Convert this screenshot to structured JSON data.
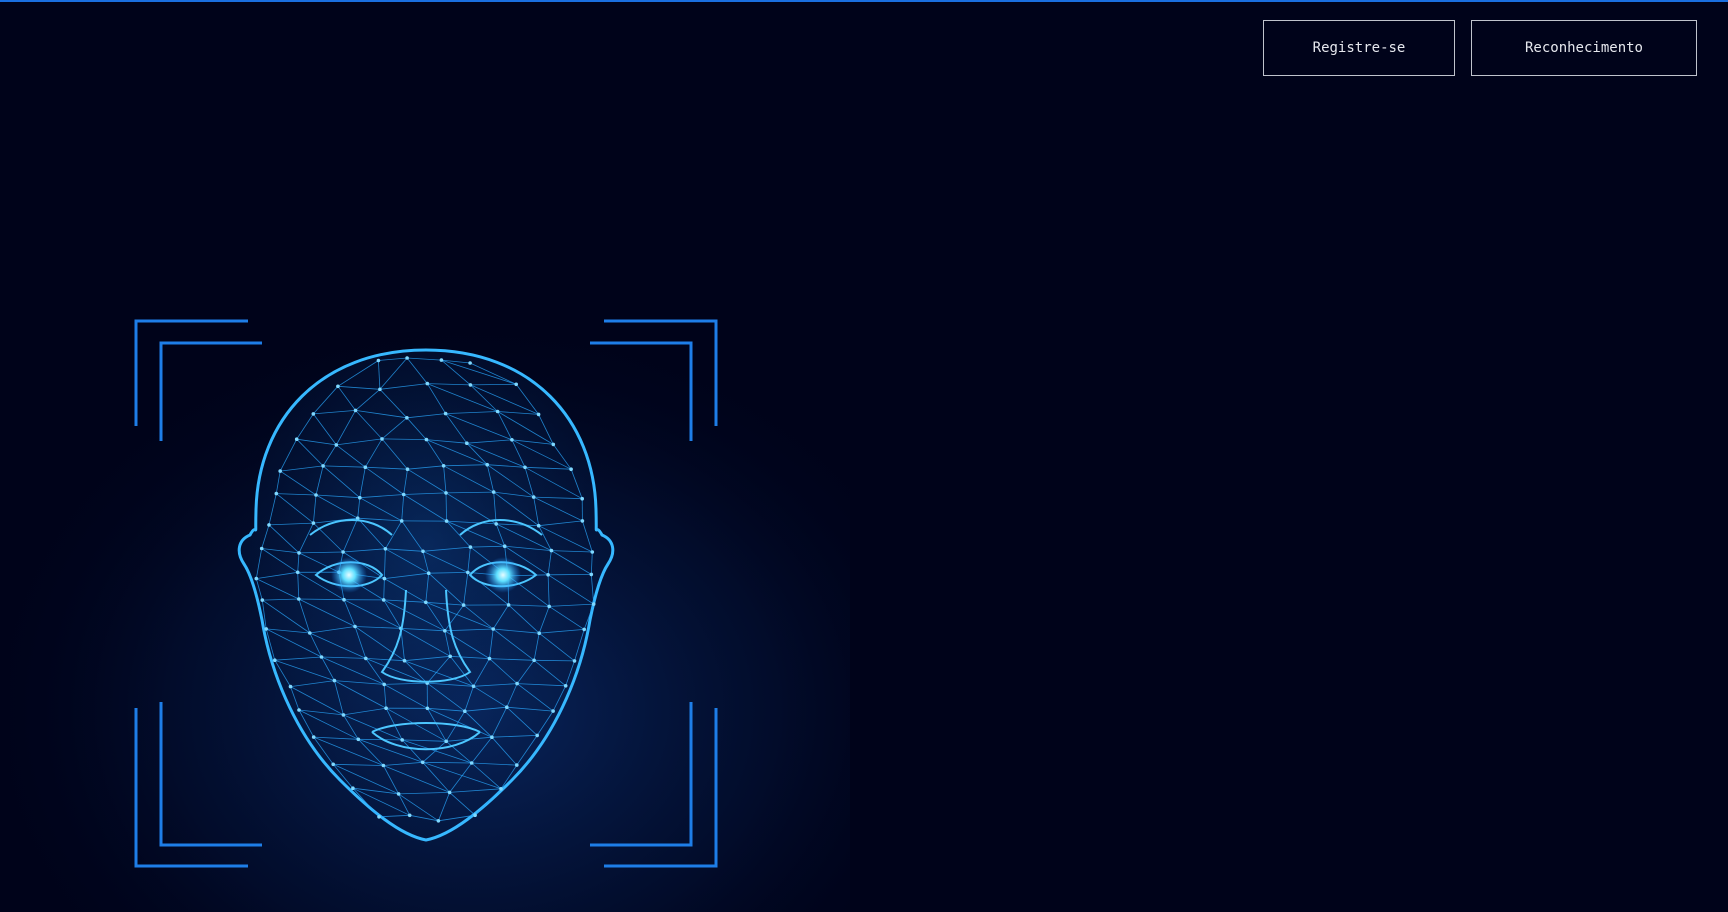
{
  "nav": {
    "register_label": "Registre-se",
    "recognition_label": "Reconhecimento"
  },
  "hero": {
    "image": "face-recognition-mesh-illustration"
  },
  "colors": {
    "background": "#00031a",
    "accent": "#1a6fe0",
    "mesh": "#2aa8ff",
    "mesh_glow": "#5fd0ff"
  }
}
